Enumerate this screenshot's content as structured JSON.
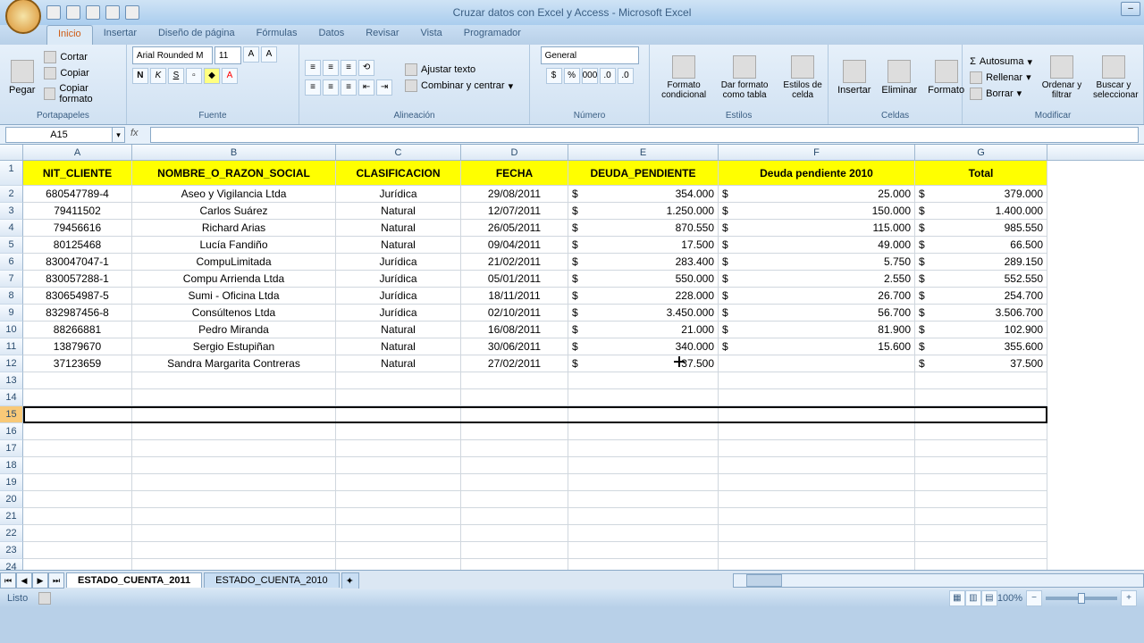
{
  "title": "Cruzar datos con Excel y Access - Microsoft Excel",
  "tabs": [
    "Inicio",
    "Insertar",
    "Diseño de página",
    "Fórmulas",
    "Datos",
    "Revisar",
    "Vista",
    "Programador"
  ],
  "active_tab": 0,
  "ribbon": {
    "portapapeles": {
      "label": "Portapapeles",
      "pegar": "Pegar",
      "cortar": "Cortar",
      "copiar": "Copiar",
      "formato": "Copiar formato"
    },
    "fuente": {
      "label": "Fuente",
      "name": "Arial Rounded M",
      "size": "11"
    },
    "alineacion": {
      "label": "Alineación",
      "ajustar": "Ajustar texto",
      "combinar": "Combinar y centrar"
    },
    "numero": {
      "label": "Número",
      "formato": "General"
    },
    "estilos": {
      "label": "Estilos",
      "cond": "Formato condicional",
      "tabla": "Dar formato como tabla",
      "celda": "Estilos de celda"
    },
    "celdas": {
      "label": "Celdas",
      "insertar": "Insertar",
      "eliminar": "Eliminar",
      "formato": "Formato"
    },
    "modificar": {
      "label": "Modificar",
      "autosuma": "Autosuma",
      "rellenar": "Rellenar",
      "borrar": "Borrar",
      "ordenar": "Ordenar y filtrar",
      "buscar": "Buscar y seleccionar"
    }
  },
  "name_box": "A15",
  "formula": "",
  "columns": [
    "A",
    "B",
    "C",
    "D",
    "E",
    "F",
    "G"
  ],
  "headers": [
    "NIT_CLIENTE",
    "NOMBRE_O_RAZON_SOCIAL",
    "CLASIFICACION",
    "FECHA",
    "DEUDA_PENDIENTE",
    "Deuda pendiente 2010",
    "Total"
  ],
  "rows": [
    {
      "nit": "680547789-4",
      "nombre": "Aseo y Vigilancia Ltda",
      "clas": "Jurídica",
      "fecha": "29/08/2011",
      "deuda": "354.000",
      "d2010": "25.000",
      "total": "379.000"
    },
    {
      "nit": "79411502",
      "nombre": "Carlos Suárez",
      "clas": "Natural",
      "fecha": "12/07/2011",
      "deuda": "1.250.000",
      "d2010": "150.000",
      "total": "1.400.000"
    },
    {
      "nit": "79456616",
      "nombre": "Richard Arias",
      "clas": "Natural",
      "fecha": "26/05/2011",
      "deuda": "870.550",
      "d2010": "115.000",
      "total": "985.550"
    },
    {
      "nit": "80125468",
      "nombre": "Lucía Fandiño",
      "clas": "Natural",
      "fecha": "09/04/2011",
      "deuda": "17.500",
      "d2010": "49.000",
      "total": "66.500"
    },
    {
      "nit": "830047047-1",
      "nombre": "CompuLimitada",
      "clas": "Jurídica",
      "fecha": "21/02/2011",
      "deuda": "283.400",
      "d2010": "5.750",
      "total": "289.150"
    },
    {
      "nit": "830057288-1",
      "nombre": "Compu Arrienda Ltda",
      "clas": "Jurídica",
      "fecha": "05/01/2011",
      "deuda": "550.000",
      "d2010": "2.550",
      "total": "552.550"
    },
    {
      "nit": "830654987-5",
      "nombre": "Sumi - Oficina Ltda",
      "clas": "Jurídica",
      "fecha": "18/11/2011",
      "deuda": "228.000",
      "d2010": "26.700",
      "total": "254.700"
    },
    {
      "nit": "832987456-8",
      "nombre": "Consúltenos Ltda",
      "clas": "Jurídica",
      "fecha": "02/10/2011",
      "deuda": "3.450.000",
      "d2010": "56.700",
      "total": "3.506.700"
    },
    {
      "nit": "88266881",
      "nombre": "Pedro Miranda",
      "clas": "Natural",
      "fecha": "16/08/2011",
      "deuda": "21.000",
      "d2010": "81.900",
      "total": "102.900"
    },
    {
      "nit": "13879670",
      "nombre": "Sergio Estupiñan",
      "clas": "Natural",
      "fecha": "30/06/2011",
      "deuda": "340.000",
      "d2010": "15.600",
      "total": "355.600"
    },
    {
      "nit": "37123659",
      "nombre": "Sandra Margarita Contreras",
      "clas": "Natural",
      "fecha": "27/02/2011",
      "deuda": "37.500",
      "d2010": "",
      "total": "37.500"
    }
  ],
  "empty_rows": 12,
  "selected_row": 15,
  "sheets": [
    "ESTADO_CUENTA_2011",
    "ESTADO_CUENTA_2010"
  ],
  "active_sheet": 0,
  "status": "Listo",
  "zoom": "100%"
}
